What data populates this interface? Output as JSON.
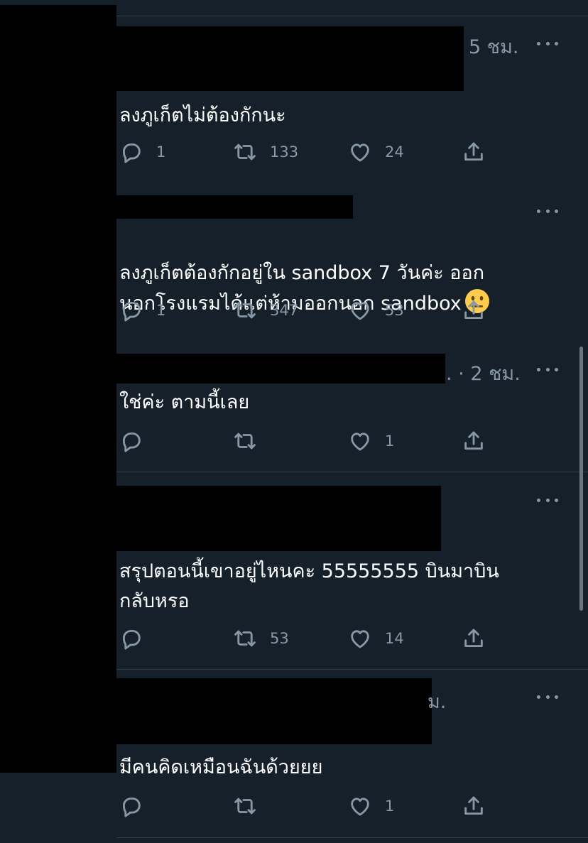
{
  "tweets": [
    {
      "time": "5 ชม.",
      "text": "ลงภูเก็ตไม่ต้องกักนะ",
      "replies": "1",
      "retweets": "133",
      "likes": "24"
    },
    {
      "time": "",
      "text": "ลงภูเก็ตต้องกักอยู่ใน sandbox 7 วันค่ะ ออก\nนอกโรงแรมได้แต่ห้ามออกนอก sandbox",
      "emoji": "neutral-face",
      "replies": "1",
      "retweets": "347",
      "likes": "53"
    },
    {
      "time": ". · 2 ชม.",
      "text": "ใช่ค่ะ ตามนี้เลย",
      "replies": "",
      "retweets": "",
      "likes": "1"
    },
    {
      "time": "",
      "text": "สรุปตอนนี้เขาอยู่ไหนคะ 55555555 บินมาบิน\nกลับหรอ",
      "replies": "",
      "retweets": "53",
      "likes": "14"
    },
    {
      "time": "ม.",
      "text": "มีคนคิดเหมือนฉันด้วยยย",
      "replies": "",
      "retweets": "",
      "likes": "1"
    }
  ],
  "colors": {
    "background": "#15202b",
    "text": "#ffffff",
    "muted": "#8899a6",
    "divider": "#2f3b47",
    "redaction": "#000000"
  },
  "icons": [
    "reply-icon",
    "retweet-icon",
    "like-icon",
    "share-icon",
    "more-options-icon"
  ]
}
